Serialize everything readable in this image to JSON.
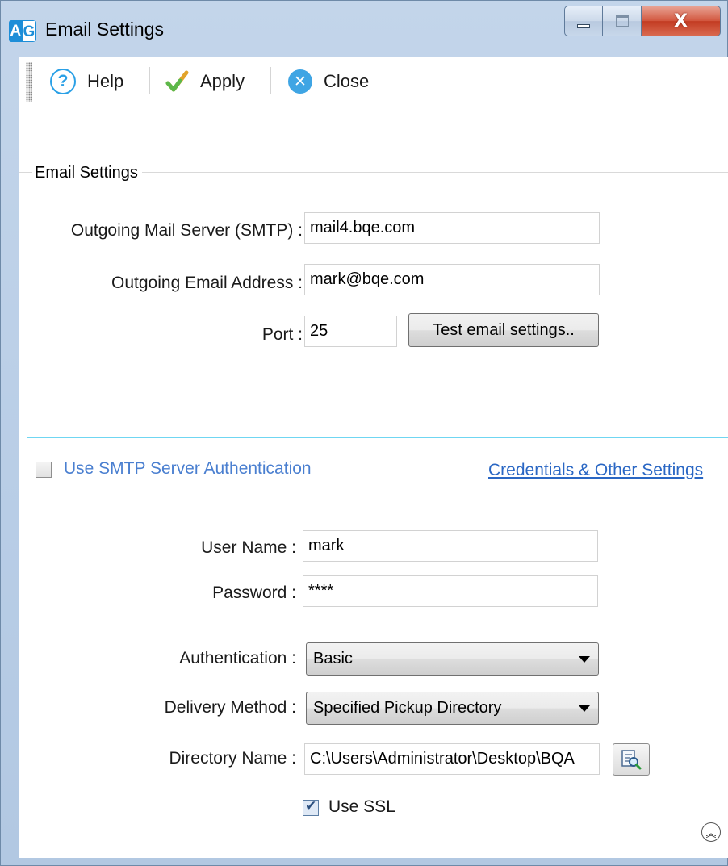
{
  "window": {
    "icon_text_a": "A",
    "icon_text_g": "G",
    "title": "Email Settings",
    "close_glyph": "X"
  },
  "toolbar": {
    "help_label": "Help",
    "apply_label": "Apply",
    "close_label": "Close"
  },
  "email_group": {
    "title": "Email Settings",
    "smtp_label": "Outgoing Mail Server (SMTP) :",
    "smtp_value": "mail4.bqe.com",
    "address_label": "Outgoing Email Address :",
    "address_value": "mark@bqe.com",
    "port_label": "Port :",
    "port_value": "25",
    "test_button": "Test email settings.."
  },
  "auth": {
    "use_smtp_auth_label": "Use SMTP Server Authentication",
    "use_smtp_auth_checked": false,
    "credentials_link": "Credentials & Other Settings",
    "username_label": "User Name :",
    "username_value": "mark",
    "password_label": "Password :",
    "password_value": "****",
    "authentication_label": "Authentication :",
    "authentication_value": "Basic",
    "delivery_label": "Delivery Method :",
    "delivery_value": "Specified Pickup Directory",
    "directory_label": "Directory Name :",
    "directory_value": "C:\\Users\\Administrator\\Desktop\\BQA",
    "use_ssl_label": "Use SSL",
    "use_ssl_checked": true
  },
  "colors": {
    "link": "#2a67c4",
    "auth_label": "#4a7fd0",
    "separator": "#6fd6f2",
    "help_icon": "#2aa0e6",
    "close_icon": "#3fa5e4"
  },
  "icons": [
    "help-icon",
    "apply-check-icon",
    "close-icon",
    "browse-folder-icon",
    "collapse-chevron-icon"
  ]
}
